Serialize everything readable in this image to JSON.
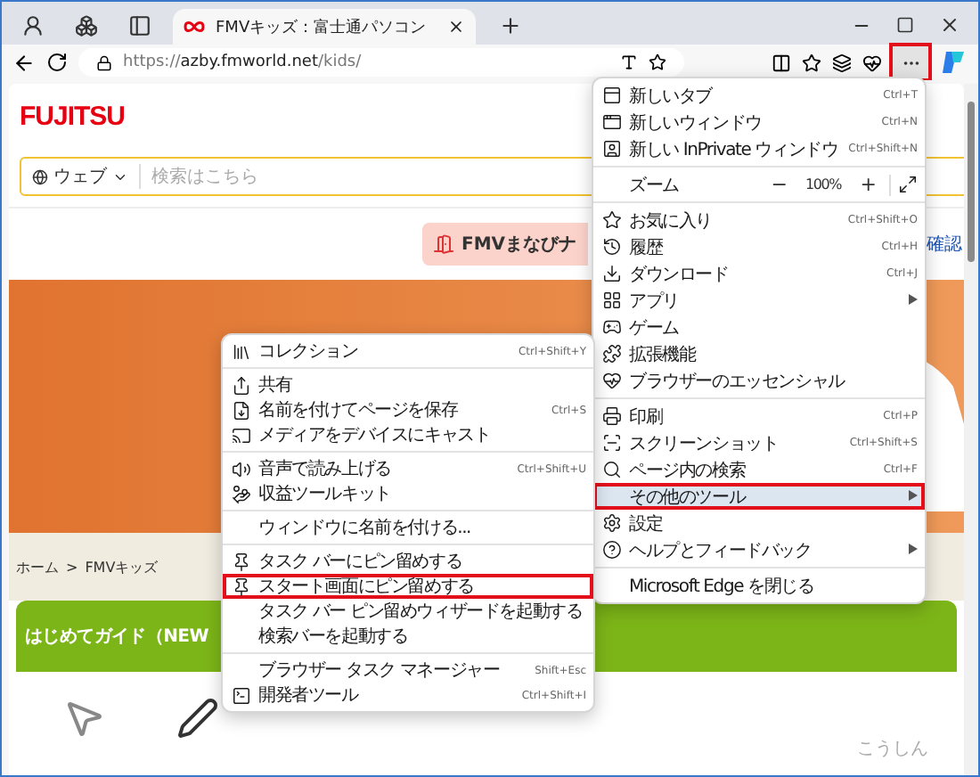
{
  "tab_strip": {
    "tabs": [
      {
        "title": "FMVキッズ：富士通パソコン",
        "selected": true
      }
    ]
  },
  "address_bar": {
    "scheme": "https://",
    "host": "azby.fmworld.net",
    "path": "/kids/"
  },
  "toolbar": {
    "more_button": {
      "outlined": true
    }
  },
  "page": {
    "logo": "FUJITSU",
    "search": {
      "scope": "ウェブ",
      "placeholder": "検索はこちら"
    },
    "nav_button": "FMVまなびナ",
    "link_fragment": "確認",
    "breadcrumb": [
      "ホーム",
      "FMVキッズ"
    ],
    "breadcrumb_separator": ">",
    "guide_heading": "はじめてガイド（NEW",
    "update_label": "こうしん"
  },
  "main_menu": {
    "items": [
      {
        "kind": "item",
        "label": "新しいタブ",
        "shortcut": "Ctrl+T",
        "arrow": false,
        "selected": false,
        "outlined": false
      },
      {
        "kind": "item",
        "label": "新しいウィンドウ",
        "shortcut": "Ctrl+N",
        "arrow": false,
        "selected": false,
        "outlined": false
      },
      {
        "kind": "item",
        "label": "新しい InPrivate ウィンドウ",
        "shortcut": "Ctrl+Shift+N",
        "arrow": false,
        "selected": false,
        "outlined": false
      },
      {
        "kind": "separator"
      },
      {
        "kind": "zoom",
        "label": "ズーム",
        "minus": "−",
        "value": "100%",
        "plus": "+"
      },
      {
        "kind": "separator"
      },
      {
        "kind": "item",
        "label": "お気に入り",
        "shortcut": "Ctrl+Shift+O",
        "arrow": false,
        "selected": false,
        "outlined": false
      },
      {
        "kind": "item",
        "label": "履歴",
        "shortcut": "Ctrl+H",
        "arrow": false,
        "selected": false,
        "outlined": false
      },
      {
        "kind": "item",
        "label": "ダウンロード",
        "shortcut": "Ctrl+J",
        "arrow": false,
        "selected": false,
        "outlined": false
      },
      {
        "kind": "item",
        "label": "アプリ",
        "arrow": true,
        "selected": false,
        "outlined": false
      },
      {
        "kind": "item",
        "label": "ゲーム",
        "arrow": false,
        "selected": false,
        "outlined": false
      },
      {
        "kind": "item",
        "label": "拡張機能",
        "arrow": false,
        "selected": false,
        "outlined": false
      },
      {
        "kind": "item",
        "label": "ブラウザーのエッセンシャル",
        "arrow": false,
        "selected": false,
        "outlined": false
      },
      {
        "kind": "separator"
      },
      {
        "kind": "item",
        "label": "印刷",
        "shortcut": "Ctrl+P",
        "arrow": false,
        "selected": false,
        "outlined": false
      },
      {
        "kind": "item",
        "label": "スクリーンショット",
        "shortcut": "Ctrl+Shift+S",
        "arrow": false,
        "selected": false,
        "outlined": false
      },
      {
        "kind": "item",
        "label": "ページ内の検索",
        "shortcut": "Ctrl+F",
        "arrow": false,
        "selected": false,
        "outlined": false
      },
      {
        "kind": "item",
        "label": "その他のツール",
        "arrow": true,
        "selected": true,
        "outlined": true
      },
      {
        "kind": "item",
        "label": "設定",
        "arrow": false,
        "selected": false,
        "outlined": false
      },
      {
        "kind": "item",
        "label": "ヘルプとフィードバック",
        "arrow": true,
        "selected": false,
        "outlined": false
      },
      {
        "kind": "separator"
      },
      {
        "kind": "item",
        "label": "Microsoft Edge を閉じる",
        "arrow": false,
        "selected": false,
        "outlined": false
      }
    ]
  },
  "submenu": {
    "items": [
      {
        "kind": "item",
        "label": "コレクション",
        "shortcut": "Ctrl+Shift+Y",
        "outlined": false
      },
      {
        "kind": "separator"
      },
      {
        "kind": "item",
        "label": "共有",
        "outlined": false
      },
      {
        "kind": "item",
        "label": "名前を付けてページを保存",
        "shortcut": "Ctrl+S",
        "outlined": false
      },
      {
        "kind": "item",
        "label": "メディアをデバイスにキャスト",
        "outlined": false
      },
      {
        "kind": "separator"
      },
      {
        "kind": "item",
        "label": "音声で読み上げる",
        "shortcut": "Ctrl+Shift+U",
        "outlined": false
      },
      {
        "kind": "item",
        "label": "収益ツールキット",
        "outlined": false
      },
      {
        "kind": "separator"
      },
      {
        "kind": "item",
        "label": "ウィンドウに名前を付ける...",
        "outlined": false
      },
      {
        "kind": "separator"
      },
      {
        "kind": "item",
        "label": "タスク バーにピン留めする",
        "outlined": false
      },
      {
        "kind": "item",
        "label": "スタート画面にピン留めする",
        "outlined": true
      },
      {
        "kind": "item",
        "label": "タスク バー ピン留めウィザードを起動する",
        "outlined": false
      },
      {
        "kind": "item",
        "label": "検索バーを起動する",
        "outlined": false
      },
      {
        "kind": "separator"
      },
      {
        "kind": "item",
        "label": "ブラウザー タスク マネージャー",
        "shortcut": "Shift+Esc",
        "outlined": false
      },
      {
        "kind": "item",
        "label": "開発者ツール",
        "shortcut": "Ctrl+Shift+I",
        "outlined": false
      }
    ]
  }
}
